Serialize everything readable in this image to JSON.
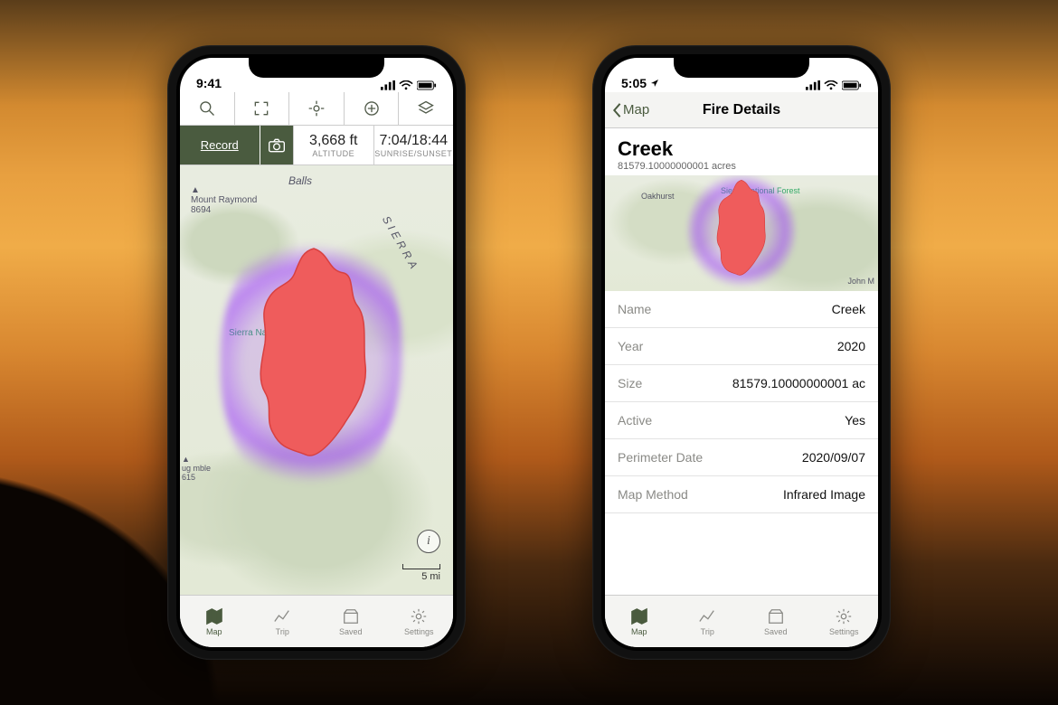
{
  "phone1": {
    "status_time": "9:41",
    "toolbar_icons": [
      "search",
      "fullscreen",
      "locate",
      "add",
      "layers"
    ],
    "record_label": "Record",
    "altitude_value": "3,668 ft",
    "altitude_label": "ALTITUDE",
    "sun_value": "7:04/18:44",
    "sun_label": "SUNRISE/SUNSET",
    "map_labels": {
      "mount": "Mount Raymond",
      "mount_elev": "8694",
      "balls": "Balls",
      "sierra_text": "SIERRA",
      "snf": "Sierra National Forest",
      "ug": "ug mble",
      "ug_elev": "615"
    },
    "scale": "5 mi",
    "tabs": [
      {
        "label": "Map",
        "active": true
      },
      {
        "label": "Trip",
        "active": false
      },
      {
        "label": "Saved",
        "active": false
      },
      {
        "label": "Settings",
        "active": false
      }
    ]
  },
  "phone2": {
    "status_time": "5:05",
    "back_label": "Map",
    "nav_title": "Fire Details",
    "fire_name": "Creek",
    "fire_sub": "81579.10000000001 acres",
    "map_labels": {
      "oakhurst": "Oakhurst",
      "snf": "Sierra National Forest",
      "john": "John M"
    },
    "rows": [
      {
        "k": "Name",
        "v": "Creek"
      },
      {
        "k": "Year",
        "v": "2020"
      },
      {
        "k": "Size",
        "v": "81579.10000000001 ac"
      },
      {
        "k": "Active",
        "v": "Yes"
      },
      {
        "k": "Perimeter Date",
        "v": "2020/09/07"
      },
      {
        "k": "Map Method",
        "v": "Infrared Image"
      }
    ],
    "tabs": [
      {
        "label": "Map",
        "active": true
      },
      {
        "label": "Trip",
        "active": false
      },
      {
        "label": "Saved",
        "active": false
      },
      {
        "label": "Settings",
        "active": false
      }
    ]
  }
}
